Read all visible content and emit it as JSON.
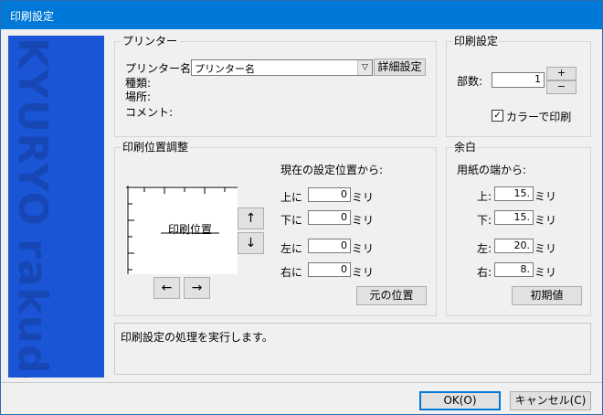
{
  "window": {
    "title": "印刷設定"
  },
  "banner": {
    "text1": "KYURYO",
    "text2": "rakuda"
  },
  "printer": {
    "legend": "プリンター",
    "name_label": "プリンター名:",
    "name_value": "プリンター名",
    "details_button": "詳細設定",
    "type_label": "種類:",
    "location_label": "場所:",
    "comment_label": "コメント:"
  },
  "print_settings": {
    "legend": "印刷設定",
    "copies_label": "部数:",
    "copies_value": "1",
    "plus": "+",
    "minus": "−",
    "color_label": "カラーで印刷"
  },
  "position": {
    "legend": "印刷位置調整",
    "from_label": "現在の設定位置から:",
    "preview_label": "印刷位置",
    "rows": [
      {
        "label": "上に",
        "value": "0",
        "unit": "ミリ"
      },
      {
        "label": "下に",
        "value": "0",
        "unit": "ミリ"
      },
      {
        "label": "左に",
        "value": "0",
        "unit": "ミリ"
      },
      {
        "label": "右に",
        "value": "0",
        "unit": "ミリ"
      }
    ],
    "up": "↑",
    "down": "↓",
    "left": "←",
    "right": "→",
    "reset_button": "元の位置"
  },
  "margin": {
    "legend": "余白",
    "from_label": "用紙の端から:",
    "rows": [
      {
        "label": "上:",
        "value": "15.",
        "unit": "ミリ"
      },
      {
        "label": "下:",
        "value": "15.",
        "unit": "ミリ"
      },
      {
        "label": "左:",
        "value": "20.",
        "unit": "ミリ"
      },
      {
        "label": "右:",
        "value": "8.",
        "unit": "ミリ"
      }
    ],
    "init_button": "初期値"
  },
  "status": {
    "message": "印刷設定の処理を実行します。"
  },
  "footer": {
    "ok": "OK(O)",
    "cancel": "キャンセル(C)"
  }
}
